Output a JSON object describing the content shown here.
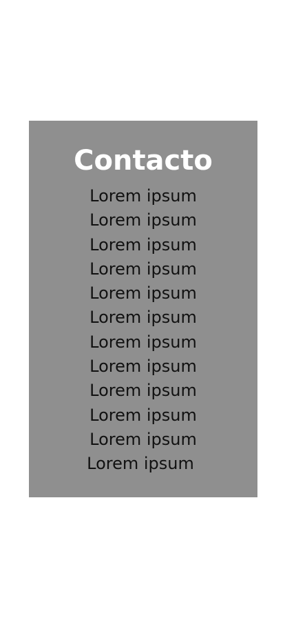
{
  "contact": {
    "title": "Contacto",
    "lines": [
      "Lorem ipsum",
      "Lorem ipsum",
      "Lorem ipsum",
      "Lorem ipsum",
      "Lorem ipsum",
      "Lorem ipsum",
      "Lorem ipsum",
      "Lorem ipsum",
      "Lorem ipsum",
      "Lorem ipsum",
      "Lorem ipsum",
      "Lorem ipsum"
    ]
  },
  "colors": {
    "page_background": "#ffffff",
    "card_background": "#8f8f8f",
    "title_text": "#ffffff",
    "body_text": "#111111"
  }
}
